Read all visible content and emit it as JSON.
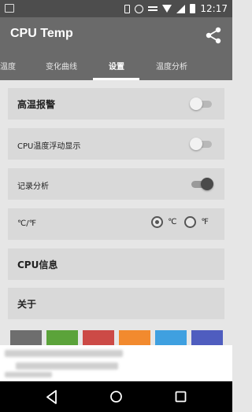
{
  "status_bar": {
    "time": "12:17",
    "icons": [
      "image-icon",
      "vibrate-icon",
      "alarm-icon",
      "key-icon",
      "wifi-icon",
      "signal-icon",
      "battery-icon"
    ]
  },
  "app_bar": {
    "title": "CPU Temp",
    "share_icon": "share-icon"
  },
  "tabs": [
    {
      "label": "温度",
      "active": false
    },
    {
      "label": "变化曲线",
      "active": false
    },
    {
      "label": "设置",
      "active": true
    },
    {
      "label": "温度分析",
      "active": false
    }
  ],
  "settings": {
    "high_temp_alarm": {
      "label": "高温报警",
      "enabled": false
    },
    "cpu_temp_float": {
      "label": "CPU温度浮动显示",
      "enabled": false
    },
    "record_analysis": {
      "label": "记录分析",
      "enabled": true
    },
    "unit": {
      "label": "℃/℉",
      "options": [
        "℃",
        "℉"
      ],
      "selected": "℃"
    },
    "cpu_info": {
      "label": "CPU信息"
    },
    "about": {
      "label": "关于"
    }
  },
  "theme_colors": [
    "#6e6e6e",
    "#5ba33a",
    "#cc4a46",
    "#f28a2e",
    "#3fa0e0",
    "#4f5dbf"
  ],
  "nav_bar": {
    "icons": [
      "back-icon",
      "home-icon",
      "recent-apps-icon"
    ]
  }
}
